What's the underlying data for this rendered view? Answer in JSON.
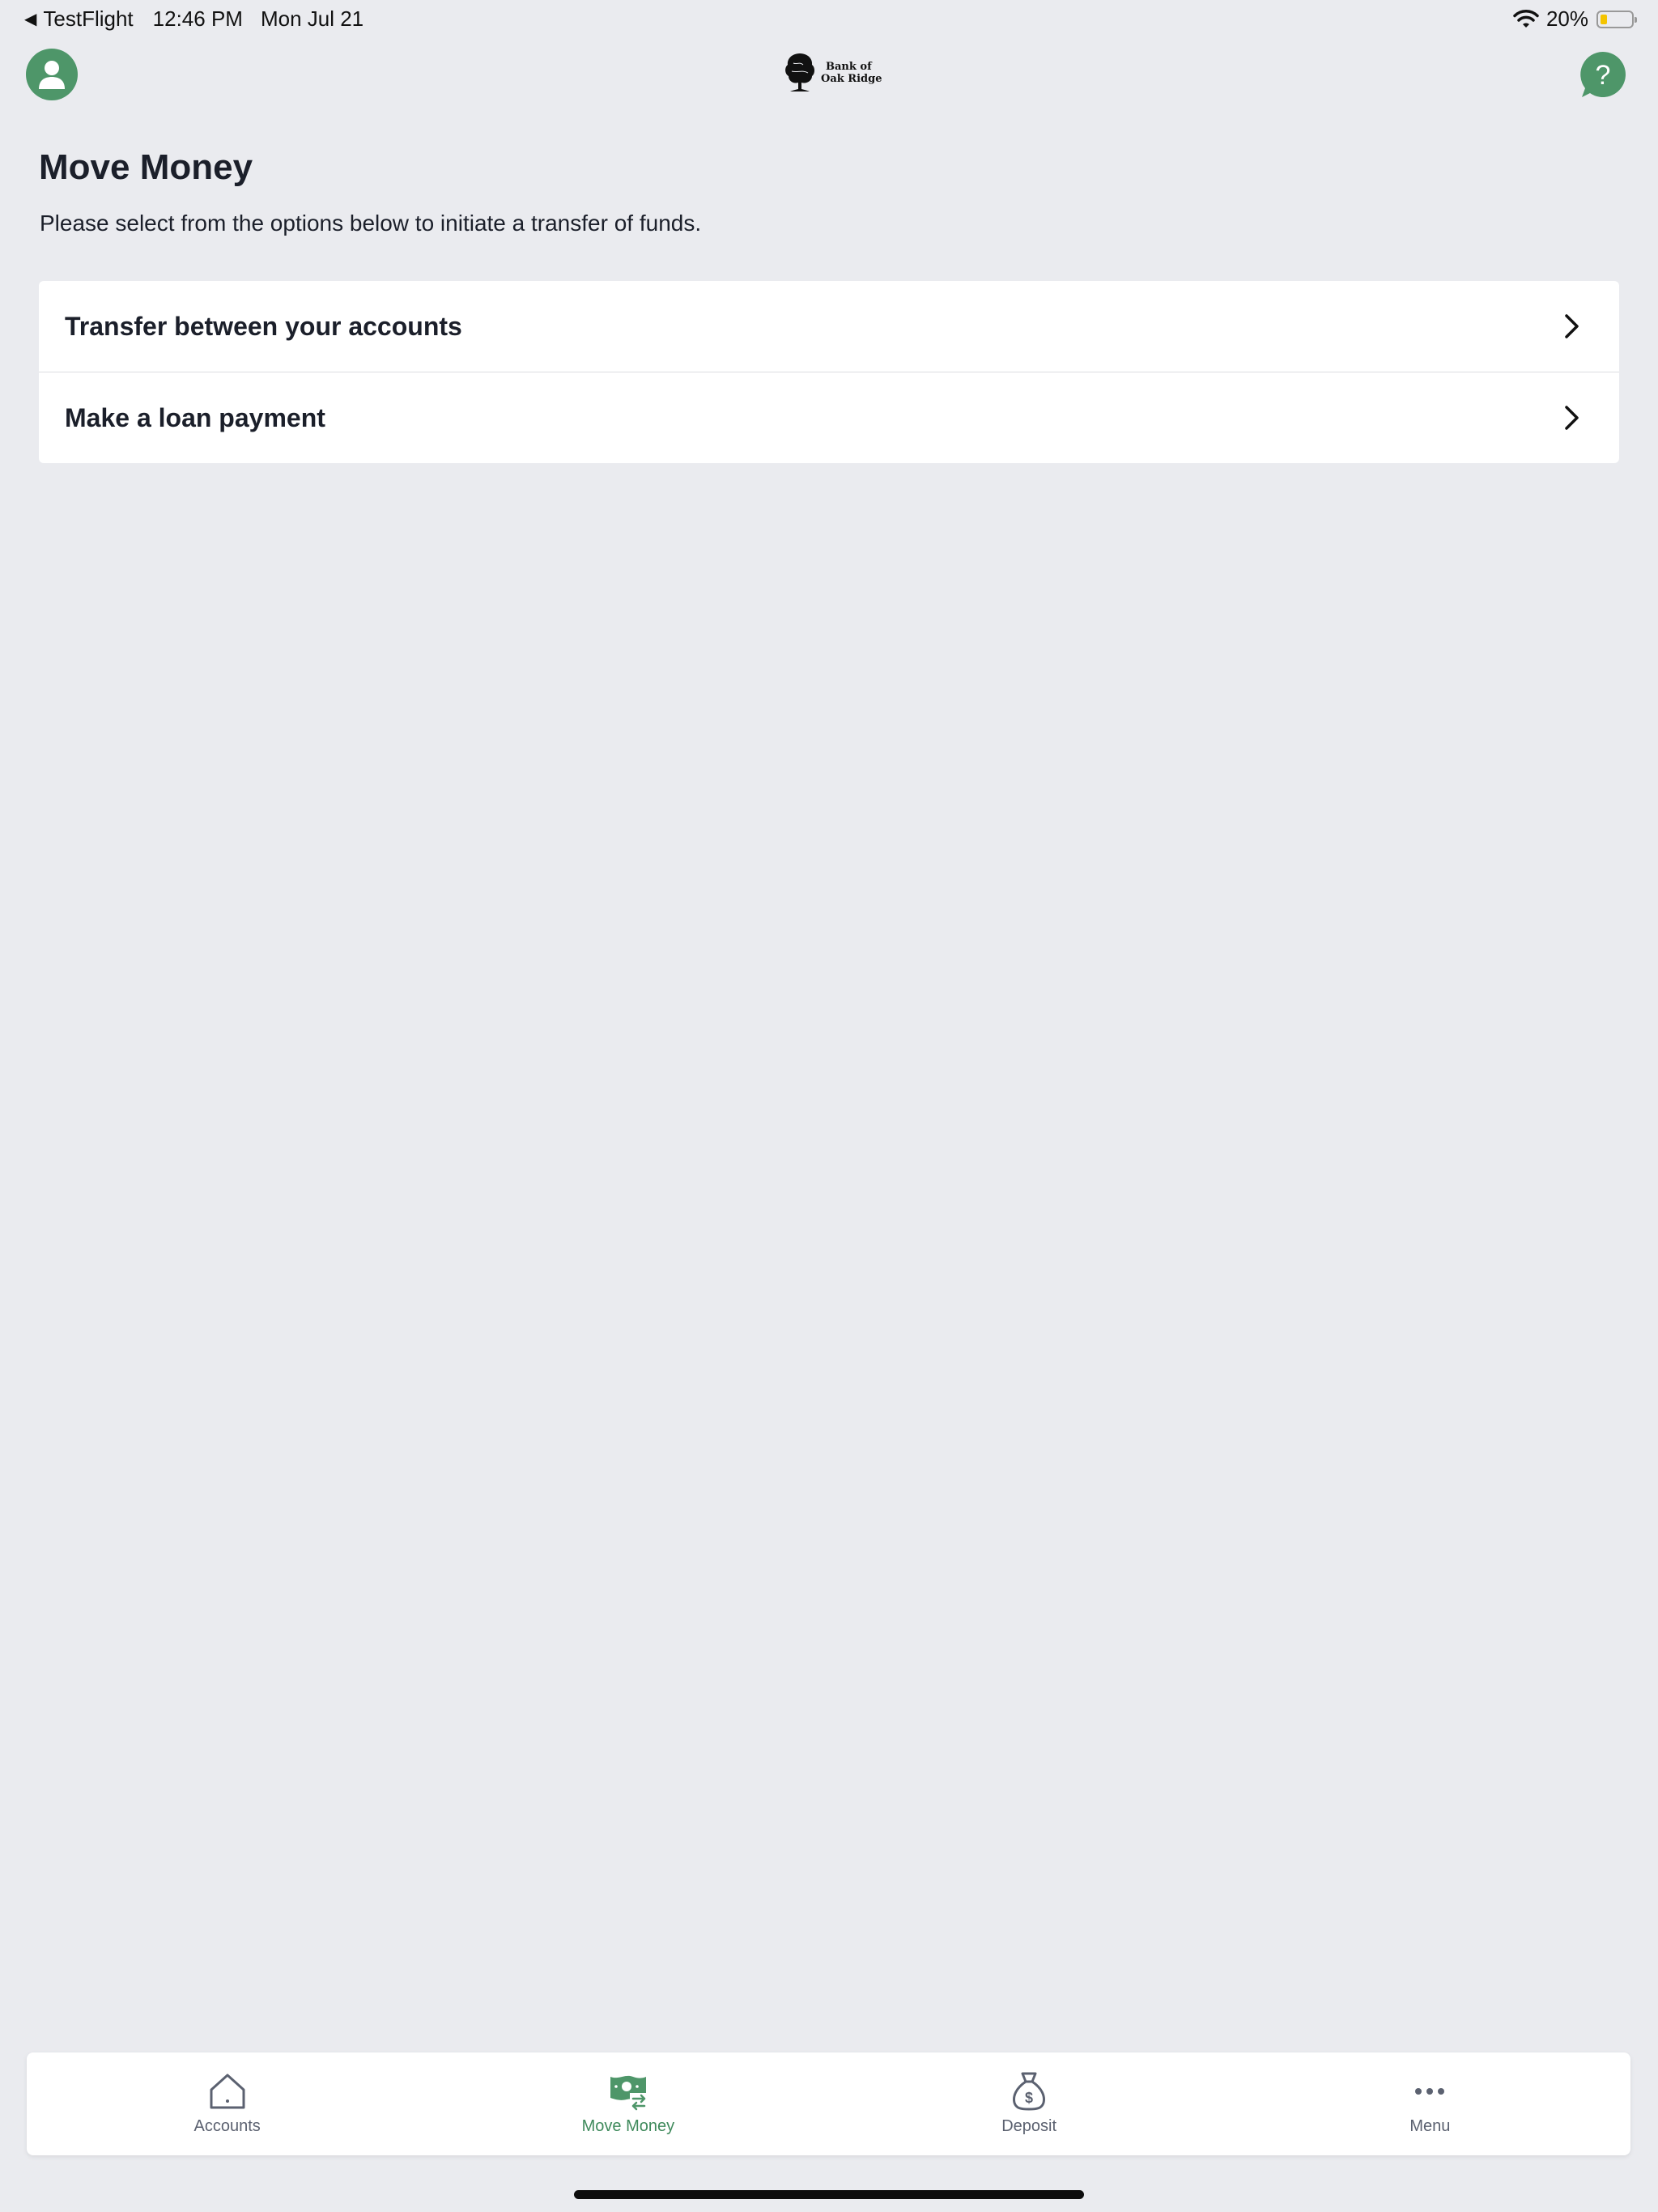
{
  "status_bar": {
    "back_app": "TestFlight",
    "time": "12:46 PM",
    "date": "Mon Jul 21",
    "battery_percent": "20%",
    "battery_level": 0.2,
    "icons": [
      "back-arrow-icon",
      "wifi-icon",
      "battery-icon"
    ]
  },
  "header": {
    "logo_line1": "Bank of",
    "logo_line2": "Oak Ridge",
    "profile_icon": "person-icon",
    "help_icon": "question-bubble-icon"
  },
  "page": {
    "title": "Move Money",
    "subtitle": "Please select from the options below to initiate a transfer of funds."
  },
  "options": [
    {
      "label": "Transfer between your accounts",
      "icon": "chevron-right-icon"
    },
    {
      "label": "Make a loan payment",
      "icon": "chevron-right-icon"
    }
  ],
  "tabs": [
    {
      "label": "Accounts",
      "icon": "home-icon",
      "active": false
    },
    {
      "label": "Move Money",
      "icon": "money-transfer-icon",
      "active": true
    },
    {
      "label": "Deposit",
      "icon": "money-bag-icon",
      "active": false
    },
    {
      "label": "Menu",
      "icon": "more-dots-icon",
      "active": false
    }
  ],
  "colors": {
    "background": "#eaebef",
    "accent": "#4e9669",
    "active_tab_text": "#3f8a5c",
    "inactive_tab_text": "#5b6170",
    "battery_fill": "#f4c400"
  }
}
